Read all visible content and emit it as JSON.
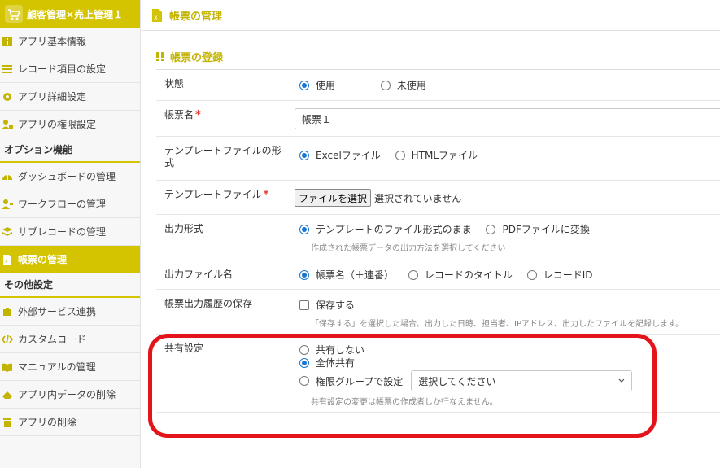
{
  "app": {
    "title": "顧客管理×売上管理１"
  },
  "sidebar": {
    "items": [
      {
        "label": "アプリ基本情報"
      },
      {
        "label": "レコード項目の設定"
      },
      {
        "label": "アプリ詳細設定"
      },
      {
        "label": "アプリの権限設定"
      }
    ],
    "option_heading": "オプション機能",
    "option_items": [
      {
        "label": "ダッシュボードの管理"
      },
      {
        "label": "ワークフローの管理"
      },
      {
        "label": "サブレコードの管理"
      },
      {
        "label": "帳票の管理"
      }
    ],
    "other_heading": "その他設定",
    "other_items": [
      {
        "label": "外部サービス連携"
      },
      {
        "label": "カスタムコード"
      },
      {
        "label": "マニュアルの管理"
      },
      {
        "label": "アプリ内データの削除"
      },
      {
        "label": "アプリの削除"
      }
    ]
  },
  "page": {
    "title": "帳票の管理",
    "section_title": "帳票の登録"
  },
  "form": {
    "status": {
      "label": "状態",
      "options": [
        "使用",
        "未使用"
      ],
      "selected": "使用"
    },
    "name": {
      "label": "帳票名",
      "required_mark": "*",
      "value": "帳票１"
    },
    "template_format": {
      "label": "テンプレートファイルの形式",
      "options": [
        "Excelファイル",
        "HTMLファイル"
      ],
      "selected": "Excelファイル"
    },
    "template_file": {
      "label": "テンプレートファイル",
      "required_mark": "*",
      "button": "ファイルを選択",
      "status": "選択されていません"
    },
    "output_format": {
      "label": "出力形式",
      "options": [
        "テンプレートのファイル形式のまま",
        "PDFファイルに変換"
      ],
      "selected": "テンプレートのファイル形式のまま",
      "help": "作成された帳票データの出力方法を選択してください"
    },
    "output_filename": {
      "label": "出力ファイル名",
      "options": [
        "帳票名（＋連番）",
        "レコードのタイトル",
        "レコードID"
      ],
      "selected": "帳票名（＋連番）"
    },
    "history": {
      "label": "帳票出力履歴の保存",
      "checkbox": "保存する",
      "checked": false,
      "help": "「保存する」を選択した場合、出力した日時、担当者、IPアドレス、出力したファイルを記録します。"
    },
    "sharing": {
      "label": "共有設定",
      "options": [
        "共有しない",
        "全体共有",
        "権限グループで設定"
      ],
      "selected": "全体共有",
      "select_placeholder": "選択してください",
      "help": "共有設定の変更は帳票の作成者しか行なえません。"
    }
  },
  "colors": {
    "accent": "#d4c400",
    "highlight": "#e3151a",
    "radio": "#1976d2"
  }
}
